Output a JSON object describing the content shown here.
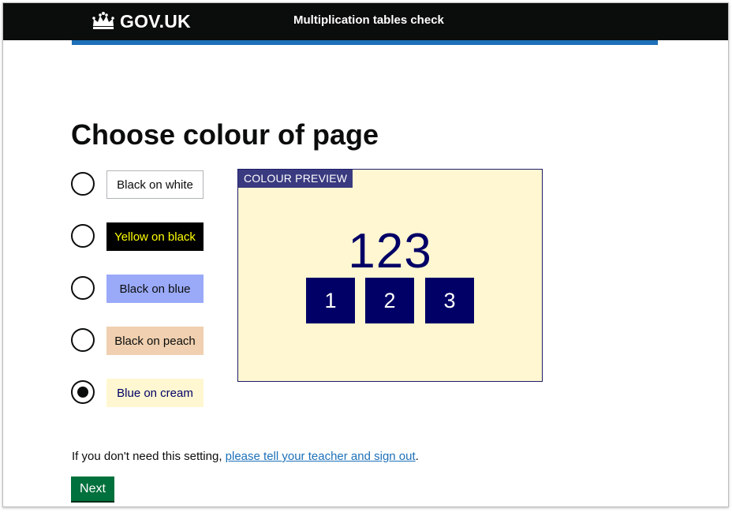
{
  "header": {
    "logo_text": "GOV.UK",
    "logo_icon": "crown-icon",
    "service_name": "Multiplication tables check",
    "accent_color": "#1d70b8"
  },
  "main": {
    "title": "Choose colour of page",
    "options": [
      {
        "label": "Black on white",
        "text_color": "#0b0c0c",
        "background": "#ffffff",
        "checked": false
      },
      {
        "label": "Yellow on black",
        "text_color": "#ffff00",
        "background": "#000000",
        "checked": false
      },
      {
        "label": "Black on blue",
        "text_color": "#0b0c0c",
        "background": "#9aaaf9",
        "checked": false
      },
      {
        "label": "Black on peach",
        "text_color": "#0b0c0c",
        "background": "#f0d0b0",
        "checked": false
      },
      {
        "label": "Blue on cream",
        "text_color": "#000066",
        "background": "#fff7d1",
        "checked": true
      }
    ],
    "preview": {
      "tag": "COLOUR PREVIEW",
      "number": "123",
      "keys": [
        "1",
        "2",
        "3"
      ],
      "background": "#fff7d1",
      "text_color": "#000066"
    },
    "note": {
      "text": "If you don't need this setting, ",
      "link": "please tell your teacher and sign out",
      "suffix": "."
    },
    "next_label": "Next"
  }
}
